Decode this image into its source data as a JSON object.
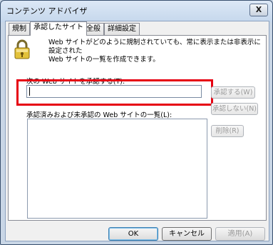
{
  "window": {
    "title": "コンテンツ アドバイザ",
    "close_label": "X"
  },
  "tabs": [
    {
      "label": "規制"
    },
    {
      "label": "承認したサイト"
    },
    {
      "label": "全般"
    },
    {
      "label": "詳細設定"
    }
  ],
  "panel": {
    "description_line1": "Web サイトがどのように規制されていても、常に表示または非表示に設定された",
    "description_line2": "Web サイトの一覧を作成できます。",
    "site_label": "次の Web サイトを承認する(T):",
    "site_input_value": "",
    "list_label": "承認済みおよび未承認の Web サイトの一覧(L):",
    "approve_button": "承認する(W)",
    "disapprove_button": "承認しない(N)",
    "delete_button": "削除(R)"
  },
  "footer": {
    "ok": "OK",
    "cancel": "キャンセル",
    "apply": "適用(A)"
  }
}
